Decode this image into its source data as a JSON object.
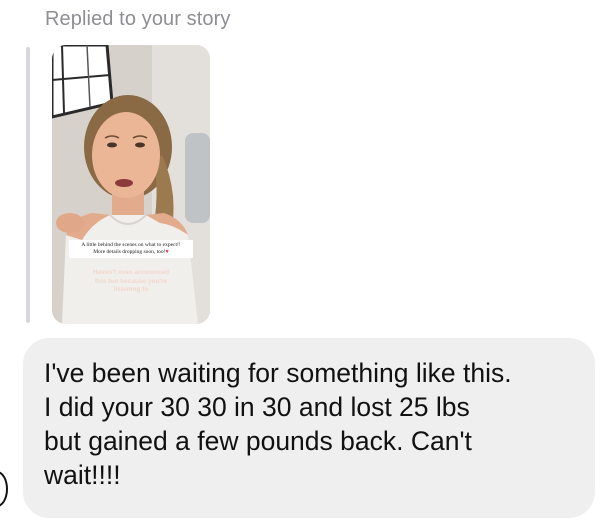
{
  "reply": {
    "label": "Replied to your story"
  },
  "story": {
    "sticker_line1": "A little behind the scenes on what to expect!!",
    "sticker_line2": "More details dropping soon, too!",
    "overlay_line1": "Haven't even announced",
    "overlay_line2": "this but because you're",
    "overlay_line3": "listening to",
    "colors": {
      "sticker_heart": "#e0314a",
      "overlay_text": "#f2d7cc"
    }
  },
  "message": {
    "line1": "I've been waiting for something like this.",
    "line2": "I did your 30 30 in 30 and lost 25 lbs",
    "line3": "but gained a few pounds back. Can't",
    "line4": "wait!!!!"
  },
  "colors": {
    "bubble_bg": "#efefef",
    "label_gray": "#8e8e93",
    "quote_bar": "#d8d8dc"
  }
}
